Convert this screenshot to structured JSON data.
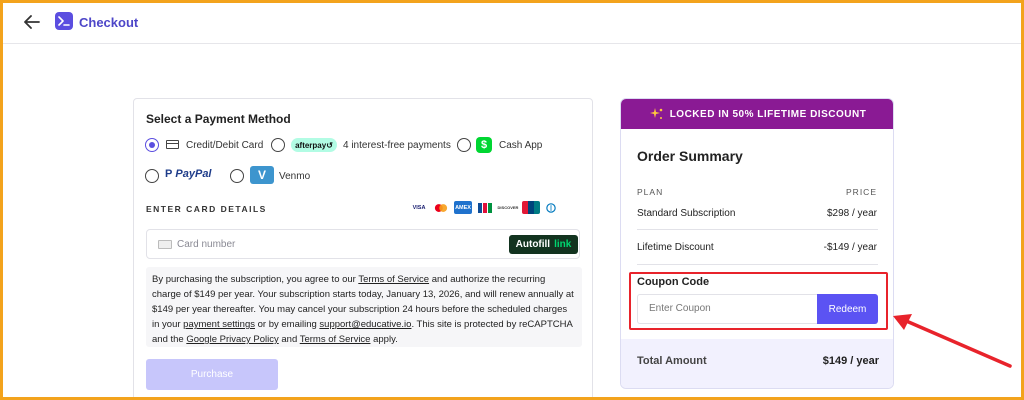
{
  "header": {
    "brand": "Checkout",
    "back_icon": "arrow-left-icon",
    "logo_icon": "terminal-logo-icon"
  },
  "payment": {
    "title": "Select a Payment Method",
    "options": [
      {
        "label": "Credit/Debit Card",
        "selected": true
      },
      {
        "label": "afterpay",
        "sub": "4 interest-free payments",
        "selected": false
      },
      {
        "label": "Cash App",
        "selected": false
      },
      {
        "label": "PayPal",
        "selected": false
      },
      {
        "label": "Venmo",
        "selected": false
      }
    ],
    "card_details_heading": "ENTER CARD DETAILS",
    "card_brands": [
      "VISA",
      "MC",
      "AMEX",
      "JCB",
      "DISCOVER",
      "UnionPay",
      "Diners"
    ],
    "card_number_placeholder": "Card number",
    "autofill": {
      "label": "Autofill",
      "link": "link"
    },
    "terms": {
      "p1": "By purchasing the subscription, you agree to our ",
      "tos": "Terms of Service",
      "p2": " and authorize the recurring charge of $149 per year. Your subscription starts today, January 13, 2026, and will renew annually at $149 per year thereafter. You may cancel your subscription 24 hours before the scheduled charges in your ",
      "payment_settings": "payment settings",
      "p3": " or by emailing ",
      "email": "support@educative.io",
      "p4": ". This site is protected by reCAPTCHA and the ",
      "privacy": "Google Privacy Policy",
      "p5": " and ",
      "tos2": "Terms of Service",
      "p6": " apply."
    },
    "purchase_label": "Purchase"
  },
  "summary": {
    "banner": "LOCKED IN 50% LIFETIME DISCOUNT",
    "title": "Order Summary",
    "col_plan": "PLAN",
    "col_price": "PRICE",
    "plan_name": "Standard Subscription",
    "plan_price": "$298 / year",
    "discount_name": "Lifetime Discount",
    "discount_price": "-$149 / year",
    "coupon_title": "Coupon Code",
    "coupon_placeholder": "Enter Coupon",
    "redeem_label": "Redeem",
    "total_label": "Total Amount",
    "total_value": "$149 / year"
  },
  "colors": {
    "accent": "#5b53f3",
    "banner": "#8a1a94",
    "highlight": "#e8232b",
    "frame": "#f3a31c"
  }
}
